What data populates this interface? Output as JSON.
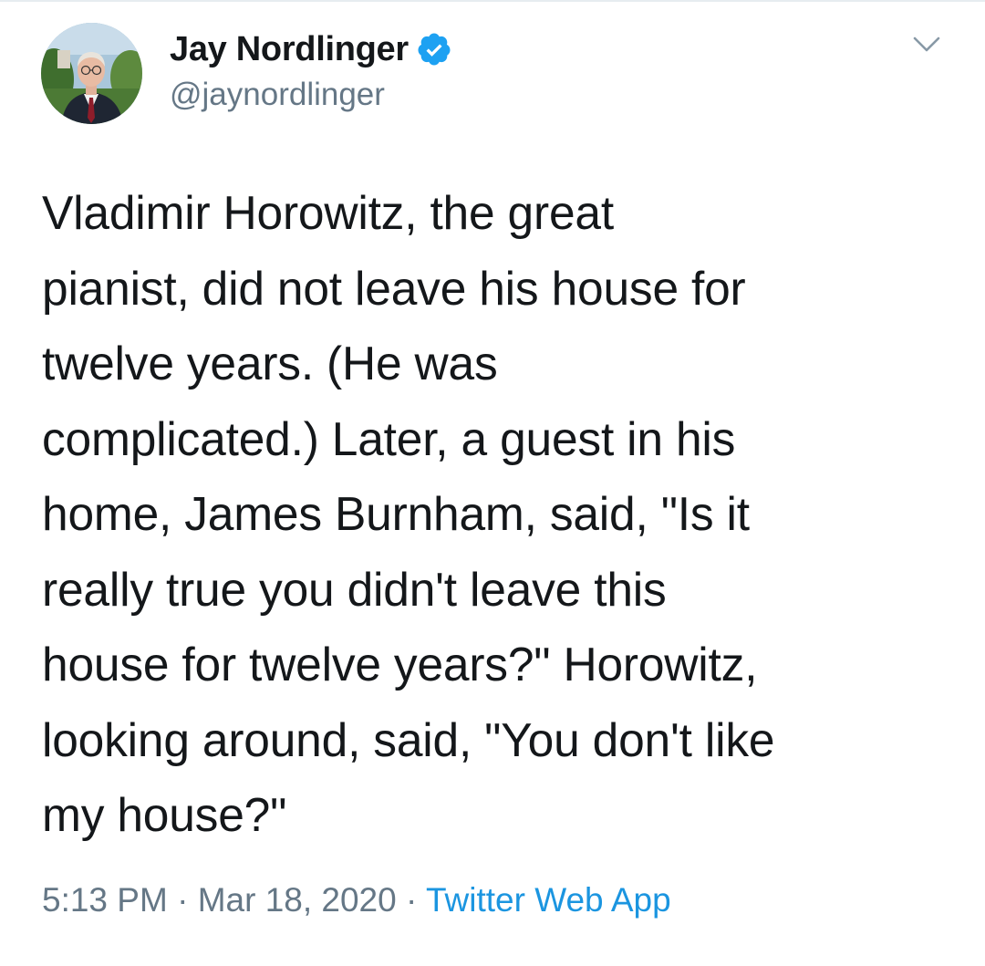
{
  "author": {
    "display_name": "Jay Nordlinger",
    "handle": "@jaynordlinger",
    "verified": true
  },
  "tweet": {
    "text": "Vladimir Horowitz, the great\npianist, did not leave his house for\ntwelve years. (He was\ncomplicated.) Later, a guest in his\nhome, James Burnham, said, \"Is it\nreally true you didn't leave this\nhouse for twelve years?\" Horowitz,\nlooking around, said, \"You don't like\nmy house?\"",
    "time": "5:13 PM",
    "separator": "·",
    "date": "Mar 18, 2020",
    "source": "Twitter Web App"
  },
  "icons": {
    "verified": "verified-badge-icon",
    "more": "chevron-down-icon"
  },
  "colors": {
    "name": "#14171a",
    "secondary": "#657786",
    "link": "#1b95e0",
    "verified": "#1da1f2"
  }
}
